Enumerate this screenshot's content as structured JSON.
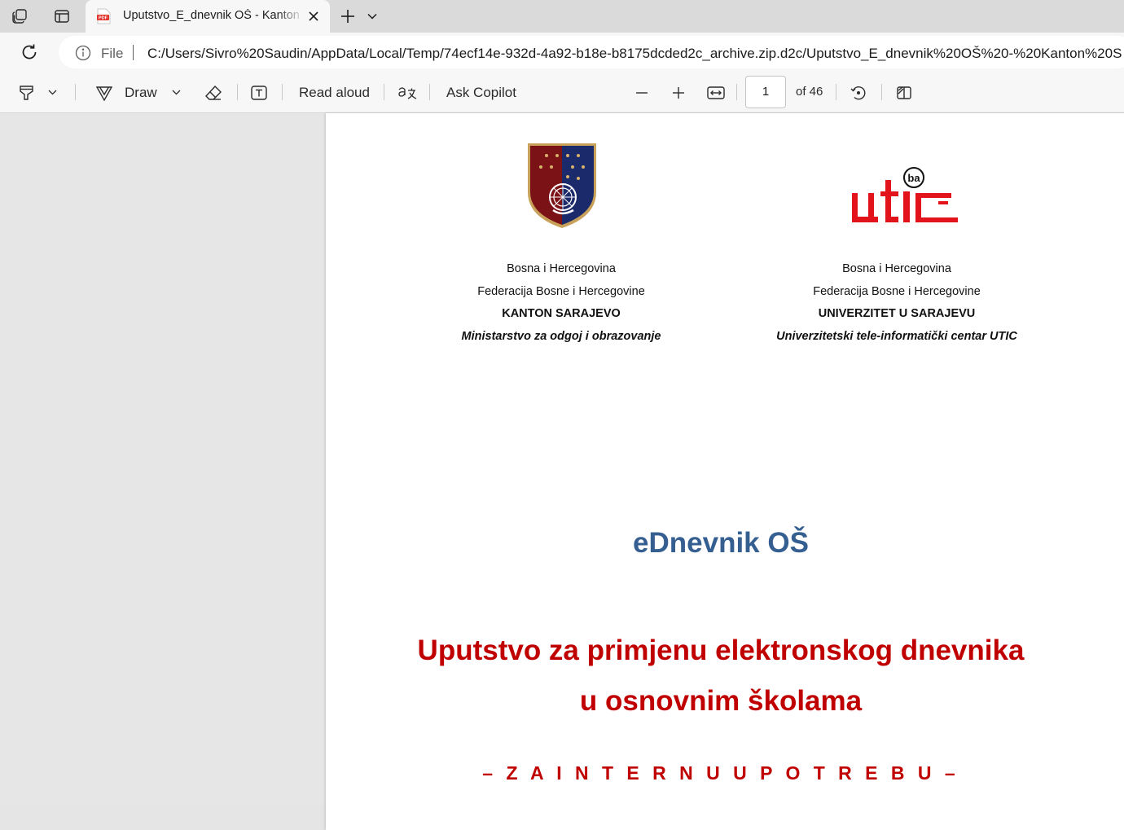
{
  "browser": {
    "tab": {
      "title": "Uputstvo_E_dnevnik OŠ - Kanton Sarajevo",
      "favicon": "pdf-icon"
    },
    "address": {
      "scheme_label": "File",
      "url": "C:/Users/Sivro%20Saudin/AppData/Local/Temp/74ecf14e-932d-4a92-b18e-b8175dcded2c_archive.zip.d2c/Uputstvo_E_dnevnik%20OŠ%20-%20Kanton%20S"
    }
  },
  "pdf_toolbar": {
    "draw_label": "Draw",
    "read_aloud_label": "Read aloud",
    "ask_copilot_label": "Ask Copilot",
    "page_number": "1",
    "page_total": "of 46"
  },
  "document": {
    "left_column": {
      "line1": "Bosna i Hercegovina",
      "line2": "Federacija Bosne i Hercegovine",
      "line3": "KANTON SARAJEVO",
      "line4": "Ministarstvo za odgoj i obrazovanje"
    },
    "right_column": {
      "line1": "Bosna i Hercegovina",
      "line2": "Federacija Bosne i Hercegovine",
      "line3": "UNIVERZITET U SARAJEVU",
      "line4": "Univerzitetski tele-informatički centar UTIC"
    },
    "logo_text": {
      "letters": "utic",
      "badge": "ba"
    },
    "subtitle": "eDnevnik OŠ",
    "title_line1": "Uputstvo za primjenu elektronskog dnevnika",
    "title_line2": "u osnovnim školama",
    "internal_note": "– Z A  I N T E R N U  U P O T R E B U –"
  },
  "colors": {
    "accent_blue": "#365f91",
    "title_red": "#c00000",
    "utic_red": "#e3131b",
    "crest_red": "#7a1216",
    "crest_blue": "#1b2a6b"
  }
}
